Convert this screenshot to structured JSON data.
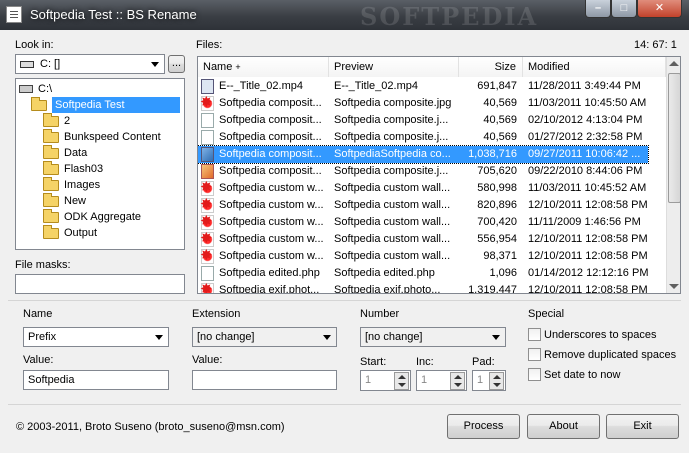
{
  "window": {
    "title": "Softpedia Test :: BS Rename",
    "watermark": "SOFTPEDIA",
    "min_label": "–",
    "max_label": "□",
    "close_label": "✕"
  },
  "left": {
    "look_in_label": "Look in:",
    "drive_value": "C: []",
    "browse_label": "...",
    "tree": [
      {
        "label": "C:\\",
        "indent": 0,
        "icon": "drive-icon",
        "selected": false
      },
      {
        "label": "Softpedia Test",
        "indent": 1,
        "icon": "open-folder-icon",
        "selected": true
      },
      {
        "label": "2",
        "indent": 2,
        "icon": "folder-icon",
        "selected": false
      },
      {
        "label": "Bunkspeed Content",
        "indent": 2,
        "icon": "folder-icon",
        "selected": false
      },
      {
        "label": "Data",
        "indent": 2,
        "icon": "folder-icon",
        "selected": false
      },
      {
        "label": "Flash03",
        "indent": 2,
        "icon": "folder-icon",
        "selected": false
      },
      {
        "label": "Images",
        "indent": 2,
        "icon": "folder-icon",
        "selected": false
      },
      {
        "label": "New",
        "indent": 2,
        "icon": "folder-icon",
        "selected": false
      },
      {
        "label": "ODK Aggregate",
        "indent": 2,
        "icon": "folder-icon",
        "selected": false
      },
      {
        "label": "Output",
        "indent": 2,
        "icon": "folder-icon",
        "selected": false
      }
    ],
    "file_masks_label": "File masks:",
    "file_masks_value": ""
  },
  "files": {
    "label": "Files:",
    "count": "14: 67: 1",
    "columns": [
      "Name",
      "Preview",
      "Size",
      "Modified"
    ],
    "rows": [
      {
        "name": "E--_Title_02.mp4",
        "preview": "E--_Title_02.mp4",
        "size": "691,847",
        "modified": "11/28/2011 3:49:44 PM",
        "icon": "video-file-icon",
        "selected": false
      },
      {
        "name": "Softpedia composit...",
        "preview": "Softpedia composite.jpg",
        "size": "40,569",
        "modified": "11/03/2011 10:45:50 AM",
        "icon": "softpedia-file-icon",
        "selected": false
      },
      {
        "name": "Softpedia composit...",
        "preview": "Softpedia composite.j...",
        "size": "40,569",
        "modified": "02/10/2012 4:13:04 PM",
        "icon": "document-file-icon",
        "selected": false
      },
      {
        "name": "Softpedia composit...",
        "preview": "Softpedia composite.j...",
        "size": "40,569",
        "modified": "01/27/2012 2:32:58 PM",
        "icon": "document-file-icon",
        "selected": false
      },
      {
        "name": "Softpedia composit...",
        "preview": "SoftpediaSoftpedia co...",
        "size": "1,038,716",
        "modified": "09/27/2011 10:06:42 ...",
        "icon": "image-file-icon",
        "selected": true
      },
      {
        "name": "Softpedia composit...",
        "preview": "Softpedia composite.j...",
        "size": "705,620",
        "modified": "09/22/2010 8:44:06 PM",
        "icon": "app-file-icon",
        "selected": false
      },
      {
        "name": "Softpedia custom w...",
        "preview": "Softpedia custom wall...",
        "size": "580,998",
        "modified": "11/03/2011 10:45:52 AM",
        "icon": "softpedia-file-icon",
        "selected": false
      },
      {
        "name": "Softpedia custom w...",
        "preview": "Softpedia custom wall...",
        "size": "820,896",
        "modified": "12/10/2011 12:08:58 PM",
        "icon": "softpedia-file-icon",
        "selected": false
      },
      {
        "name": "Softpedia custom w...",
        "preview": "Softpedia custom wall...",
        "size": "700,420",
        "modified": "11/11/2009 1:46:56 PM",
        "icon": "softpedia-file-icon",
        "selected": false
      },
      {
        "name": "Softpedia custom w...",
        "preview": "Softpedia custom wall...",
        "size": "556,954",
        "modified": "12/10/2011 12:08:58 PM",
        "icon": "softpedia-file-icon",
        "selected": false
      },
      {
        "name": "Softpedia custom w...",
        "preview": "Softpedia custom wall...",
        "size": "98,371",
        "modified": "12/10/2011 12:08:58 PM",
        "icon": "softpedia-file-icon",
        "selected": false
      },
      {
        "name": "Softpedia edited.php",
        "preview": "Softpedia edited.php",
        "size": "1,096",
        "modified": "01/14/2012 12:12:16 PM",
        "icon": "document-file-icon",
        "selected": false
      },
      {
        "name": "Softpedia exif.phot...",
        "preview": "Softpedia exif.photo...",
        "size": "1,319,447",
        "modified": "12/10/2011 12:08:58 PM",
        "icon": "softpedia-file-icon",
        "selected": false
      }
    ]
  },
  "name_group": {
    "title": "Name",
    "mode_value": "Prefix",
    "value_label": "Value:",
    "value": "Softpedia"
  },
  "extension_group": {
    "title": "Extension",
    "mode_value": "[no change]",
    "value_label": "Value:",
    "value": ""
  },
  "number_group": {
    "title": "Number",
    "mode_value": "[no change]",
    "start_label": "Start:",
    "start_value": "1",
    "inc_label": "Inc:",
    "inc_value": "1",
    "pad_label": "Pad:",
    "pad_value": "1"
  },
  "special_group": {
    "title": "Special",
    "options": [
      "Underscores to spaces",
      "Remove duplicated spaces",
      "Set date to now"
    ]
  },
  "footer": {
    "copyright": "© 2003-2011, Broto Suseno (broto_suseno@msn.com)",
    "process_label": "Process",
    "about_label": "About",
    "exit_label": "Exit"
  },
  "colors": {
    "selection": "#3399ff",
    "title_bar": "#3a3e44",
    "close_button": "#c2422b"
  }
}
